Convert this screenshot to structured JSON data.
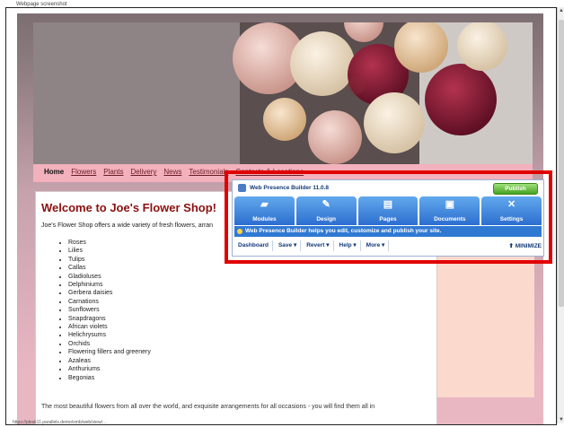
{
  "caption": "Webpage screenshot",
  "nav": {
    "items": [
      "Home",
      "Flowers",
      "Plants",
      "Delivery",
      "News",
      "Testimonials",
      "Contacts & Locations"
    ]
  },
  "content": {
    "title": "Welcome to Joe's Flower Shop!",
    "intro": "Joe's Flower Shop offers a wide variety of fresh flowers, arran",
    "flowers": [
      "Roses",
      "Lilies",
      "Tulips",
      "Callas",
      "Gladioluses",
      "Delphiniums",
      "Gerbera daisies",
      "Carnations",
      "Sunflowers",
      "Snapdragons",
      "African violets",
      "Helichrysums",
      "Orchids",
      "Flowering fillers and greenery",
      "Azaleas",
      "Anthuriums",
      "Begonias"
    ],
    "footer": "The most beautiful flowers from all over the world, and exquisite arrangements for all occasions - you will find them all in"
  },
  "status_url": "https://plesk11.parallels.demo/smb/web/view/...",
  "builder": {
    "title": "Web Presence Builder 11.0.8",
    "publish": "Publish",
    "tabs": [
      "Modules",
      "Design",
      "Pages",
      "Documents",
      "Settings"
    ],
    "tab_icons": [
      "modules-icon",
      "design-icon",
      "pages-icon",
      "documents-icon",
      "settings-icon"
    ],
    "info": "Web Presence Builder helps you edit, customize and publish your site.",
    "toolbar": [
      "Dashboard",
      "Save ▾",
      "Revert ▾",
      "Help ▾",
      "More ▾"
    ],
    "minimize": "⬆ MINIMIZE"
  },
  "colors": {
    "highlight": "#e10000",
    "tab_blue": "#2c6ed0",
    "publish_green": "#45a321",
    "title_red": "#8b1010"
  }
}
